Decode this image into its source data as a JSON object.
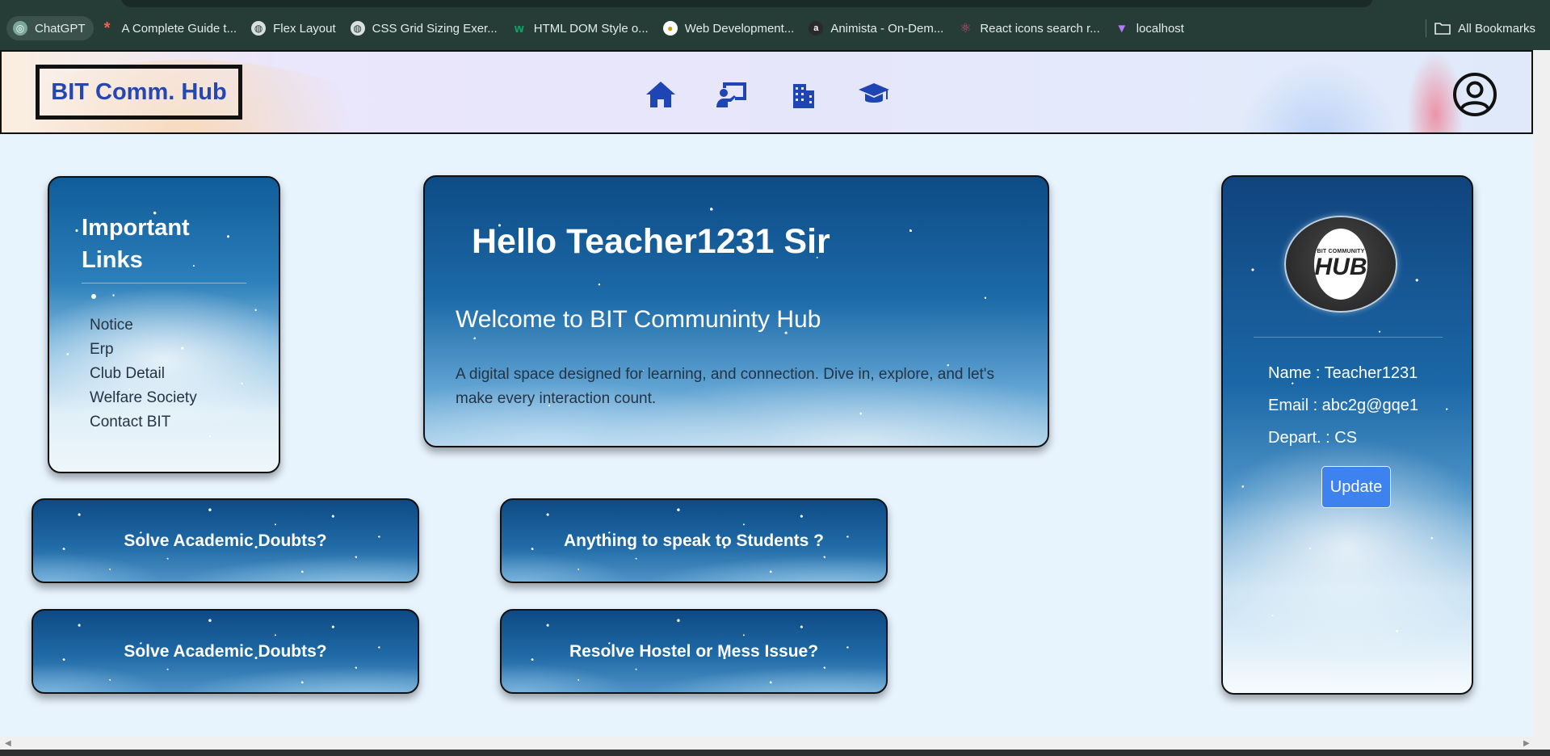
{
  "browser": {
    "bookmarks": [
      {
        "label": "ChatGPT",
        "icon": "chatgpt-icon"
      },
      {
        "label": "A Complete Guide t...",
        "icon": "asterisk-icon"
      },
      {
        "label": "Flex Layout",
        "icon": "globe-icon"
      },
      {
        "label": "CSS Grid Sizing Exer...",
        "icon": "globe-icon"
      },
      {
        "label": "HTML DOM Style o...",
        "icon": "w3schools-icon"
      },
      {
        "label": "Web Development...",
        "icon": "site-icon"
      },
      {
        "label": "Animista - On-Dem...",
        "icon": "animista-icon"
      },
      {
        "label": "React icons search r...",
        "icon": "react-icon"
      },
      {
        "label": "localhost",
        "icon": "vite-icon"
      }
    ],
    "all_bookmarks_label": "All Bookmarks"
  },
  "navbar": {
    "brand": "BIT Comm. Hub",
    "icons": [
      "home-icon",
      "teacher-icon",
      "building-icon",
      "graduation-cap-icon"
    ],
    "profile_icon": "user-circle-icon",
    "brand_color": "#2447b3"
  },
  "links": {
    "title": "Important Links",
    "items": [
      "Notice",
      "Erp",
      "Club Detail",
      "Welfare Society",
      "Contact BIT"
    ]
  },
  "hero": {
    "greeting": "Hello Teacher1231 Sir",
    "welcome": "Welcome to BIT Communinty Hub",
    "description": "A digital space designed for learning, and connection. Dive in, explore, and let's make every interaction count."
  },
  "actions": [
    "Solve Academic Doubts?",
    "Anything to speak to Students ?",
    "Solve Academic Doubts?",
    "Resolve Hostel or Mess Issue?"
  ],
  "profile": {
    "logo_top": "BIT COMMUNITY",
    "logo_main": "HUB",
    "name_line": "Name : Teacher1231",
    "email_line": "Email : abc2g@gqe1",
    "dept_line": "Depart. : CS",
    "update_label": "Update",
    "update_color": "#3d82ee"
  }
}
